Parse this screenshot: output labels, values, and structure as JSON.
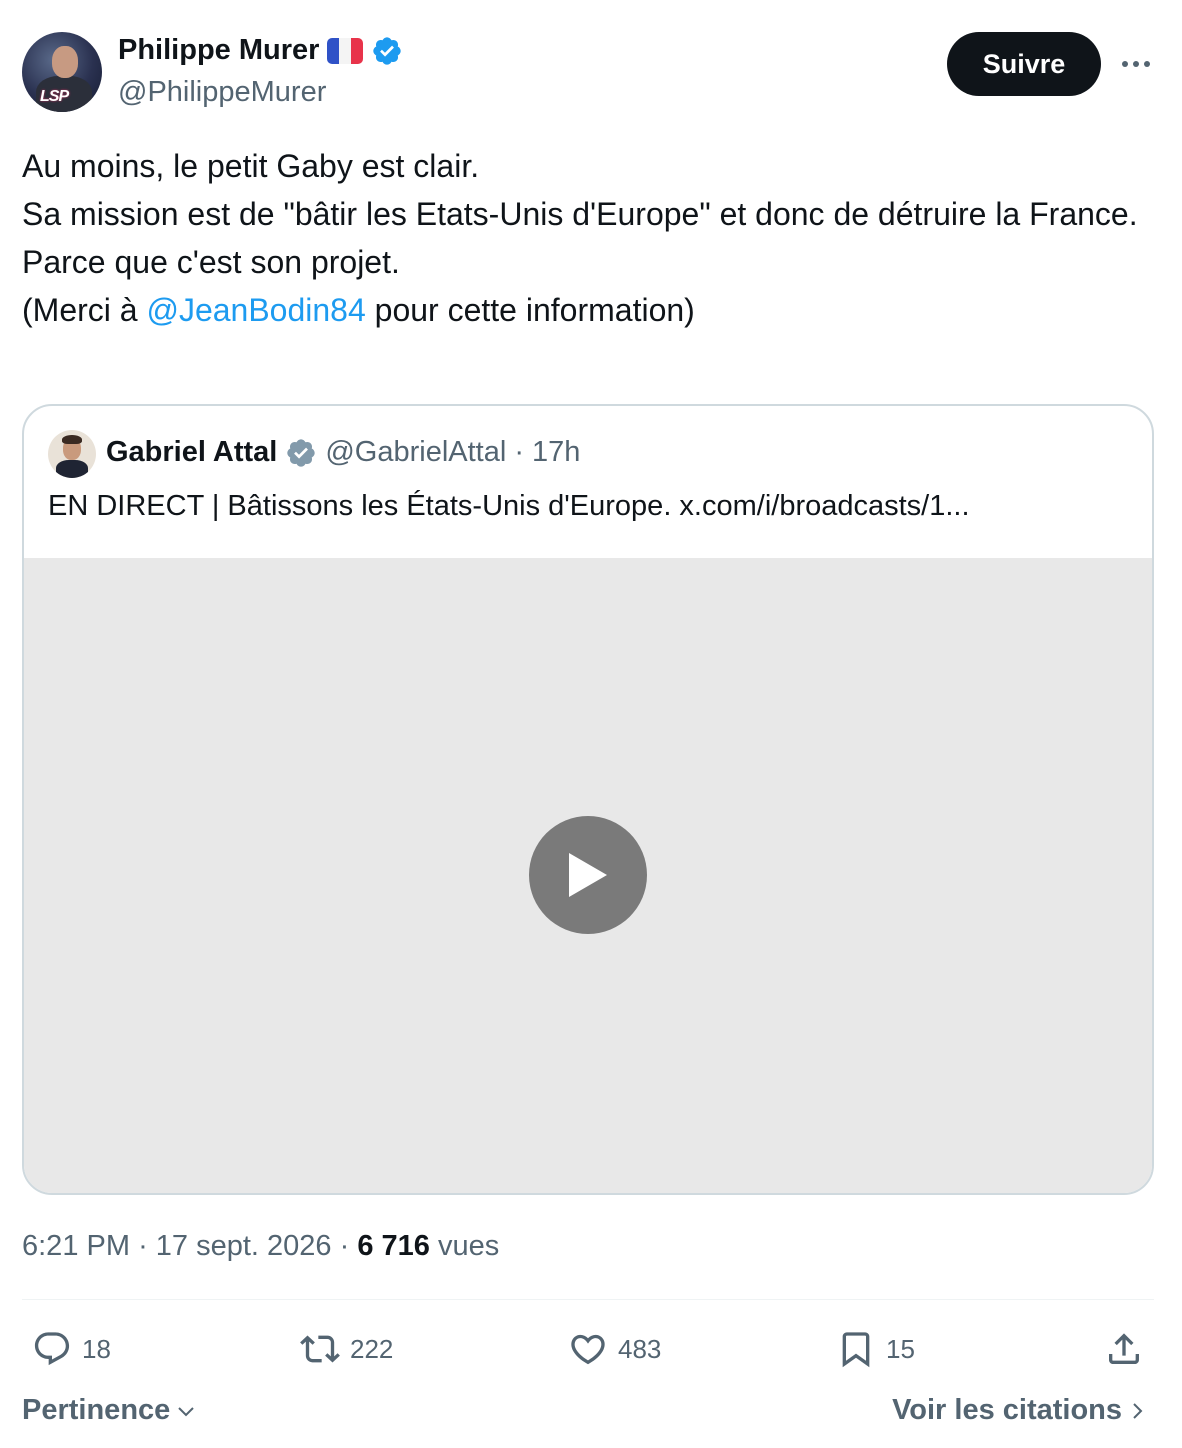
{
  "author": {
    "display_name": "Philippe Murer",
    "handle": "@PhilippeMurer",
    "avatar_logo_text": "LSP",
    "flag_icon": "france-flag-icon",
    "verified_color": "#1d9bf0"
  },
  "header": {
    "follow_label": "Suivre",
    "more_icon": "more-horizontal-icon"
  },
  "tweet": {
    "line1": "Au moins, le petit Gaby est clair.",
    "line2": "Sa mission est de \"bâtir les Etats-Unis d'Europe\" et donc de détruire la France.",
    "line3": "Parce que c'est son projet.",
    "line4_prefix": "(Merci à ",
    "line4_mention": "@JeanBodin84",
    "line4_suffix": " pour cette information)"
  },
  "quote": {
    "display_name": "Gabriel Attal",
    "handle": "@GabrielAttal",
    "separator": "·",
    "time": "17h",
    "text": "EN DIRECT | Bâtissons les États-Unis d'Europe. x.com/i/broadcasts/1...",
    "verified_color": "#829aab",
    "play_icon": "play-icon"
  },
  "meta": {
    "time": "6:21 PM",
    "separator": "·",
    "date": "17 sept. 2026",
    "views_count": "6 716",
    "views_label": "vues"
  },
  "actions": {
    "replies": "18",
    "reposts": "222",
    "likes": "483",
    "bookmarks": "15"
  },
  "footer": {
    "sort_label": "Pertinence",
    "quotes_label": "Voir les citations"
  },
  "colors": {
    "text_primary": "#0f1419",
    "text_secondary": "#536471",
    "accent": "#1d9bf0",
    "button_bg": "#0f1419",
    "border": "#cfd9de",
    "media_bg": "#e8e8e8"
  }
}
